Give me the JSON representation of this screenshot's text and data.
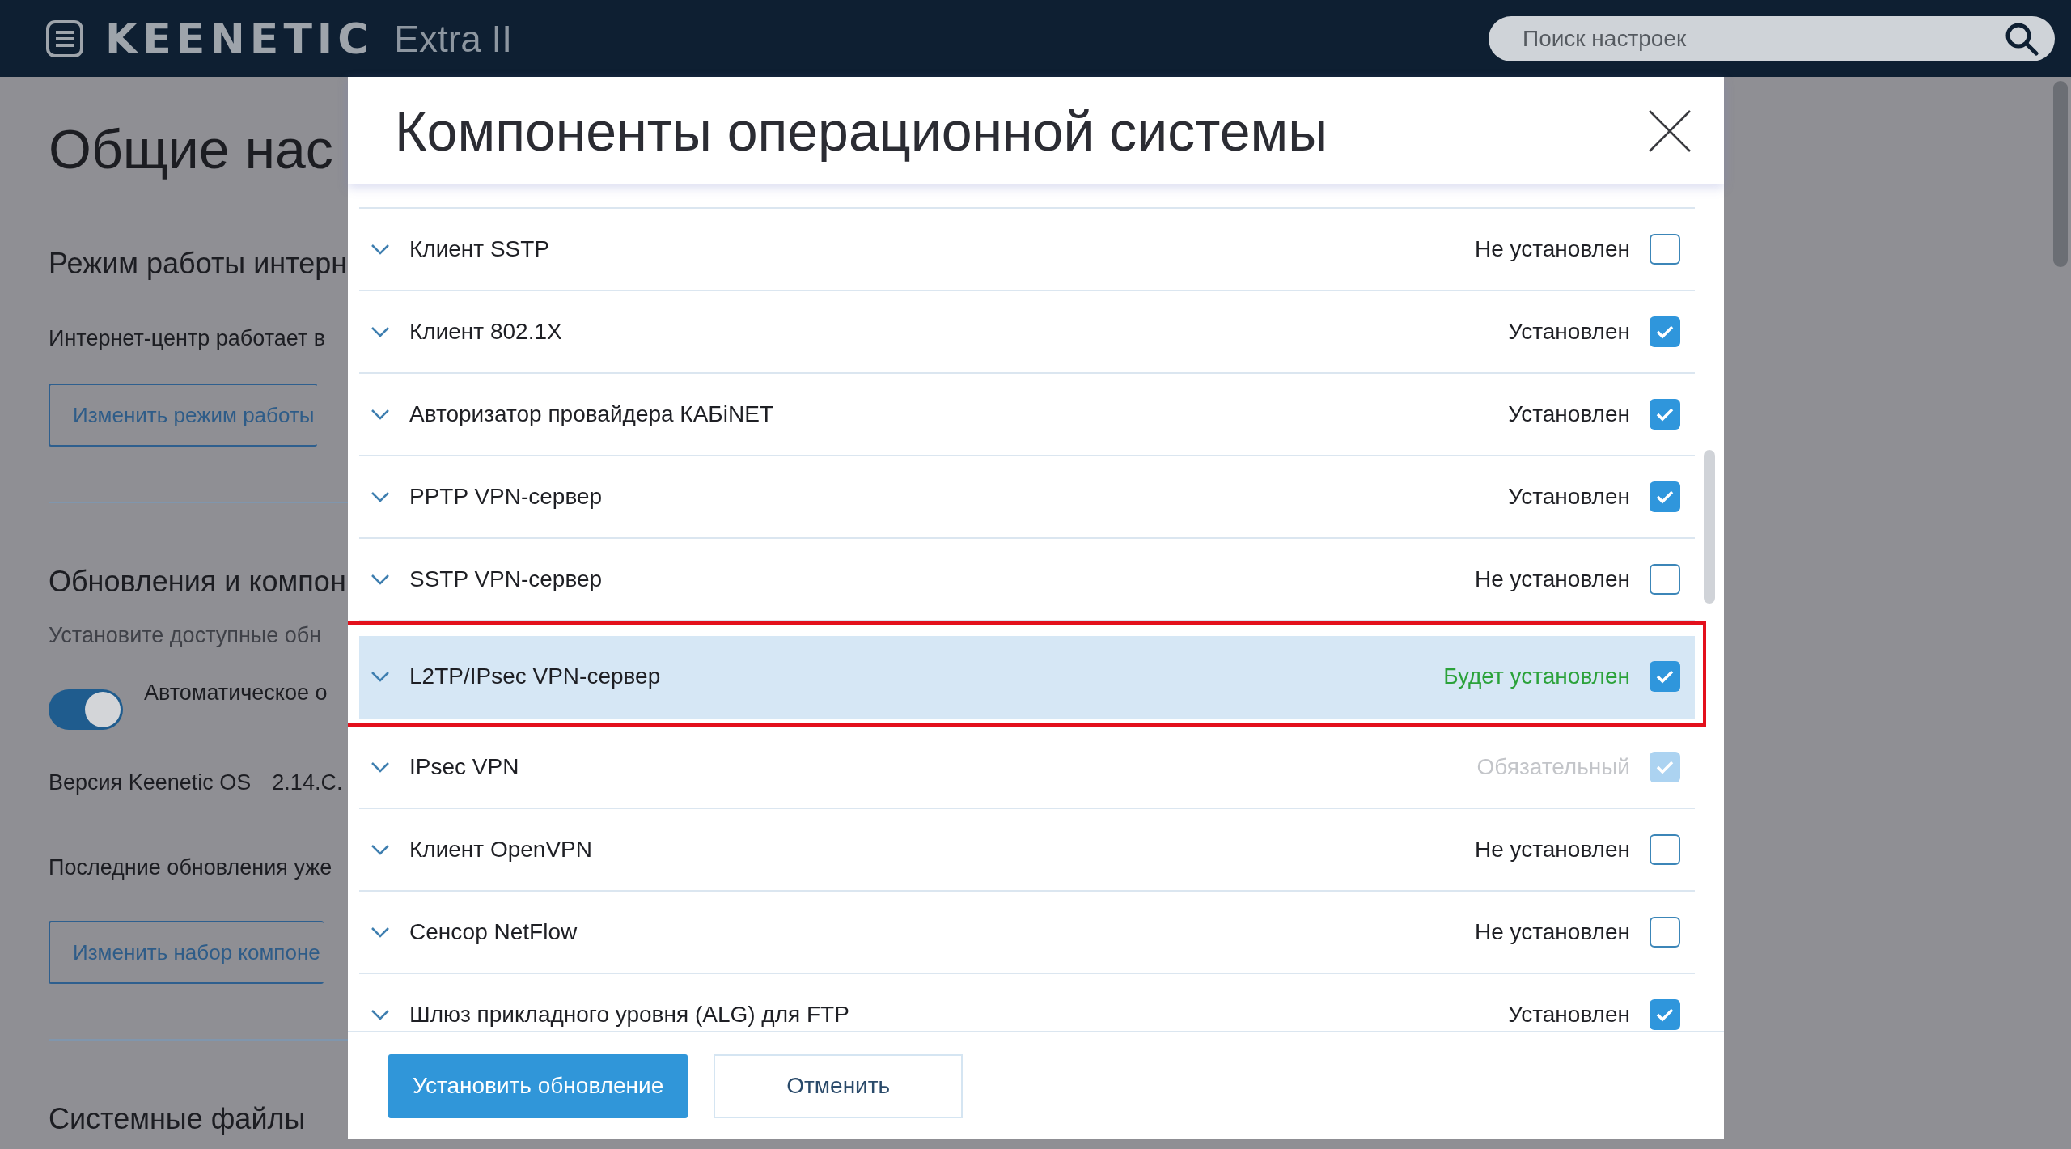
{
  "top_bar": {
    "logo": "KEENETIC",
    "model": "Extra II",
    "search": {
      "placeholder": "Поиск настроек"
    }
  },
  "page": {
    "title": "Общие нас",
    "sections": [
      {
        "heading": "Режим работы интерн",
        "text": "Интернет-центр работает в",
        "button": "Изменить режим работы"
      },
      {
        "heading": "Обновления и компон",
        "text": "Установите доступные обн",
        "toggle": {
          "label": "Автоматическое о",
          "on": true
        },
        "version_label": "Версия Keenetic OS",
        "version": "2.14.C.",
        "status": "Последние обновления уже",
        "button": "Изменить набор компоне"
      },
      {
        "heading": "Системные файлы"
      }
    ]
  },
  "dialog": {
    "title": "Компоненты операционной системы",
    "components": [
      {
        "name": "Клиент SSTP",
        "status": "Не установлен",
        "kind": "absent",
        "checked": false,
        "disabled": false,
        "selected": false
      },
      {
        "name": "Клиент 802.1X",
        "status": "Установлен",
        "kind": "installed",
        "checked": true,
        "disabled": false,
        "selected": false
      },
      {
        "name": "Авторизатор провайдера КАБiNET",
        "status": "Установлен",
        "kind": "installed",
        "checked": true,
        "disabled": false,
        "selected": false
      },
      {
        "name": "PPTP VPN-сервер",
        "status": "Установлен",
        "kind": "installed",
        "checked": true,
        "disabled": false,
        "selected": false
      },
      {
        "name": "SSTP VPN-сервер",
        "status": "Не установлен",
        "kind": "absent",
        "checked": false,
        "disabled": false,
        "selected": false
      },
      {
        "name": "L2TP/IPsec VPN-сервер",
        "status": "Будет установлен",
        "kind": "pending",
        "checked": true,
        "disabled": false,
        "selected": true
      },
      {
        "name": "IPsec VPN",
        "status": "Обязательный",
        "kind": "required",
        "checked": true,
        "disabled": true,
        "selected": false
      },
      {
        "name": "Клиент OpenVPN",
        "status": "Не установлен",
        "kind": "absent",
        "checked": false,
        "disabled": false,
        "selected": false
      },
      {
        "name": "Сенсор NetFlow",
        "status": "Не установлен",
        "kind": "absent",
        "checked": false,
        "disabled": false,
        "selected": false
      },
      {
        "name": "Шлюз прикладного уровня (ALG) для FTP",
        "status": "Установлен",
        "kind": "installed",
        "checked": true,
        "disabled": false,
        "selected": false
      }
    ],
    "buttons": {
      "primary": "Установить обновление",
      "secondary": "Отменить"
    }
  }
}
